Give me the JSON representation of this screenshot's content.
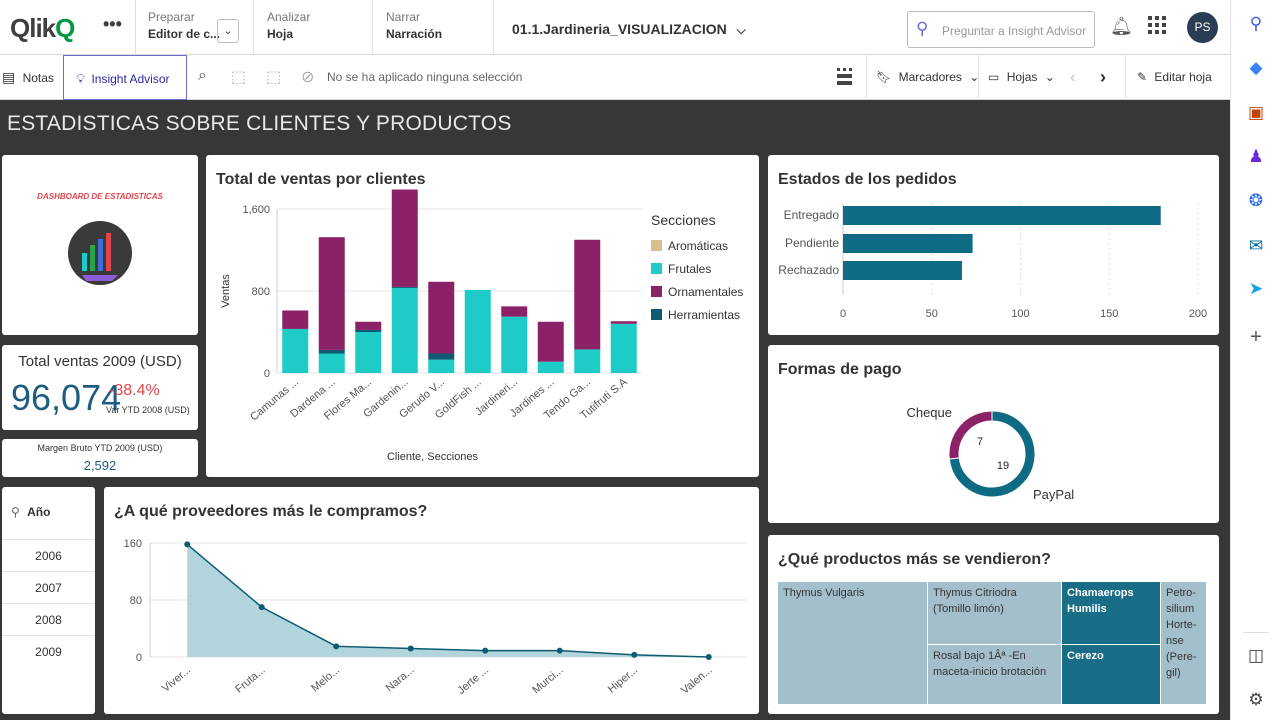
{
  "topbar": {
    "logo_text": "Qlik",
    "logo_q": "Q",
    "more": "•••",
    "prepare_small": "Preparar",
    "prepare_big": "Editor de c...",
    "analyze_small": "Analizar",
    "analyze_big": "Hoja",
    "narrate_small": "Narrar",
    "narrate_big": "Narración",
    "app_title": "01.1.Jardineria_VISUALIZACION",
    "ask_placeholder": "Preguntar a Insight Advisor",
    "avatar_initials": "PS"
  },
  "toolbar": {
    "notes": "Notas",
    "insight": "Insight Advisor",
    "no_selection": "No se ha aplicado ninguna selección",
    "bookmarks": "Marcadores",
    "sheets": "Hojas",
    "edit_sheet": "Editar hoja"
  },
  "sheet": {
    "title": "ESTADISTICAS SOBRE CLIENTES Y PRODUCTOS",
    "dashboard_label": "DASHBOARD DE ESTADISTICAS"
  },
  "kpi_total": {
    "title": "Total ventas 2009 (USD)",
    "value": "96,074",
    "delta": "-38.4%",
    "delta_label": "Var YTD 2008 (USD)"
  },
  "kpi_margin": {
    "title": "Margen Bruto YTD 2009 (USD)",
    "value": "2,592"
  },
  "year_filter": {
    "label": "Año",
    "years": [
      "2006",
      "2007",
      "2008",
      "2009"
    ]
  },
  "colors": {
    "teal": "#1ecbc6",
    "plum": "#8b2268",
    "dark_teal": "#0e5b72",
    "tan": "#d7bf8f",
    "petrol": "#0d6b84",
    "area": "#a9cfd9",
    "light_tm": "#a4bfcc"
  },
  "chart_data": [
    {
      "type": "bar",
      "title": "Total de ventas por clientes",
      "xlabel": "Cliente, Secciones",
      "ylabel": "Ventas",
      "ylim": [
        0,
        1600
      ],
      "yticks": [
        "0",
        "800",
        "1,600"
      ],
      "legend_title": "Secciones",
      "legend": "right",
      "categories": [
        "Camunas ...",
        "Dardena ...",
        "Flores Ma...",
        "Gardenin...",
        "Gerudo V...",
        "GoldFish ...",
        "Jardineri...",
        "Jardines ...",
        "Tendo Ga...",
        "Tutifruti S.A"
      ],
      "series": [
        {
          "name": "Aromáticas",
          "color": "#d7bf8f",
          "values": [
            0,
            0,
            0,
            0,
            0,
            0,
            0,
            0,
            0,
            0
          ]
        },
        {
          "name": "Frutales",
          "color": "#1ecbc6",
          "values": [
            430,
            190,
            400,
            830,
            130,
            810,
            550,
            110,
            230,
            480
          ]
        },
        {
          "name": "Herramientas",
          "color": "#0e5b72",
          "values": [
            0,
            35,
            20,
            10,
            60,
            0,
            0,
            0,
            0,
            0
          ]
        },
        {
          "name": "Ornamentales",
          "color": "#8b2268",
          "values": [
            180,
            1100,
            80,
            950,
            700,
            0,
            100,
            390,
            1070,
            25
          ]
        }
      ]
    },
    {
      "type": "bar",
      "title": "Estados de los pedidos",
      "orientation": "horizontal",
      "categories": [
        "Entregado",
        "Pendiente",
        "Rechazado"
      ],
      "values": [
        179,
        73,
        67
      ],
      "xlim": [
        0,
        200
      ],
      "xticks": [
        "0",
        "50",
        "100",
        "150",
        "200"
      ]
    },
    {
      "type": "pie",
      "title": "Formas de pago",
      "donut": true,
      "labels": [
        "Cheque",
        "PayPal"
      ],
      "values": [
        7,
        19
      ],
      "value_labels": [
        "7",
        "19"
      ]
    },
    {
      "type": "area",
      "title": "¿A qué proveedores más le compramos?",
      "categories": [
        "Viver...",
        "Fruta...",
        "Melo...",
        "Nara...",
        "Jerte ...",
        "Murci...",
        "Hiper...",
        "Valen..."
      ],
      "values": [
        158,
        70,
        15,
        12,
        9,
        9,
        3,
        0
      ],
      "ylim": [
        0,
        160
      ],
      "yticks": [
        "0",
        "80",
        "160"
      ]
    },
    {
      "type": "treemap",
      "title": "¿Qué productos más se vendieron?",
      "labels": [
        "Thymus Vulgaris",
        "Thymus Citriodra (Tomillo limón)",
        "Rosal bajo 1Âª -En maceta-inicio brotación",
        "Chamaerops Humilis",
        "Cerezo",
        "Petro-silium Horte-nse (Pere-gil)"
      ]
    }
  ]
}
